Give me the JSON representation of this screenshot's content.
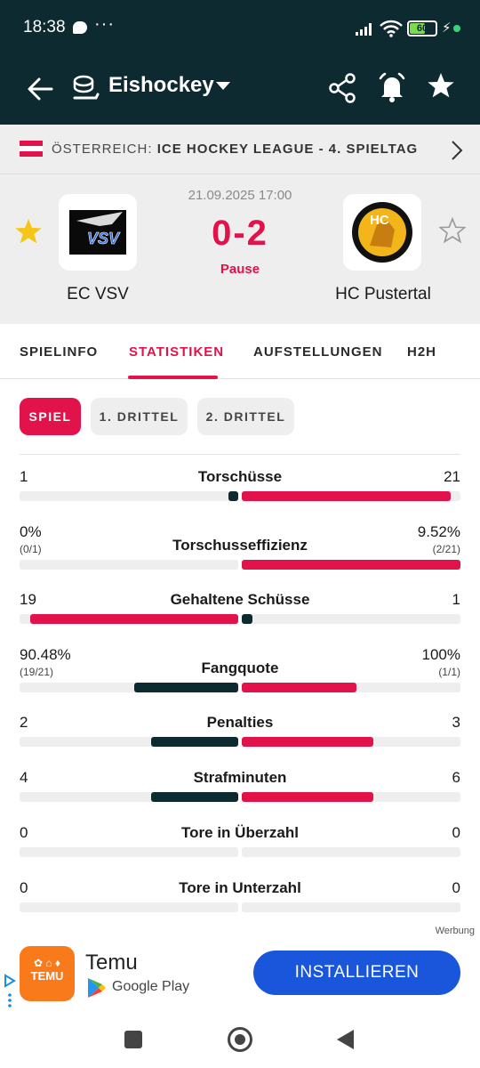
{
  "status_bar": {
    "time": "18:38",
    "dots": "···",
    "battery": "60"
  },
  "app_bar": {
    "title": "Eishockey"
  },
  "league": {
    "country": "ÖSTERREICH:",
    "name": "ICE HOCKEY LEAGUE - 4. SPIELTAG",
    "flag_colors": [
      "#e2124a",
      "#ffffff",
      "#e2124a"
    ]
  },
  "match": {
    "datetime": "21.09.2025 17:00",
    "score": "0-2",
    "status": "Pause",
    "home": {
      "name": "EC VSV",
      "logo_text": "VSV",
      "favorite": true
    },
    "away": {
      "name": "HC Pustertal",
      "logo_text": "HC",
      "favorite": false
    }
  },
  "tabs": [
    "SPIELINFO",
    "STATISTIKEN",
    "AUFSTELLUNGEN",
    "H2H"
  ],
  "active_tab": "STATISTIKEN",
  "periods": [
    "SPIEL",
    "1. DRITTEL",
    "2. DRITTEL"
  ],
  "active_period": "SPIEL",
  "stats": [
    {
      "label": "Torschüsse",
      "home": "1",
      "away": "21",
      "home_sub": "",
      "away_sub": "",
      "home_frac": 0.045,
      "away_frac": 0.955,
      "home_color": "dark",
      "away_color": "red"
    },
    {
      "label": "Torschusseffizienz",
      "home": "0%",
      "away": "9.52%",
      "home_sub": "(0/1)",
      "away_sub": "(2/21)",
      "home_frac": 0.0,
      "away_frac": 1.0,
      "home_color": "dark",
      "away_color": "red"
    },
    {
      "label": "Gehaltene Schüsse",
      "home": "19",
      "away": "1",
      "home_sub": "",
      "away_sub": "",
      "home_frac": 0.95,
      "away_frac": 0.05,
      "home_color": "red",
      "away_color": "dark"
    },
    {
      "label": "Fangquote",
      "home": "90.48%",
      "away": "100%",
      "home_sub": "(19/21)",
      "away_sub": "(1/1)",
      "home_frac": 0.475,
      "away_frac": 0.525,
      "home_color": "dark",
      "away_color": "red"
    },
    {
      "label": "Penalties",
      "home": "2",
      "away": "3",
      "home_sub": "",
      "away_sub": "",
      "home_frac": 0.4,
      "away_frac": 0.6,
      "home_color": "dark",
      "away_color": "red"
    },
    {
      "label": "Strafminuten",
      "home": "4",
      "away": "6",
      "home_sub": "",
      "away_sub": "",
      "home_frac": 0.4,
      "away_frac": 0.6,
      "home_color": "dark",
      "away_color": "red"
    },
    {
      "label": "Tore in Überzahl",
      "home": "0",
      "away": "0",
      "home_sub": "",
      "away_sub": "",
      "home_frac": 0,
      "away_frac": 0,
      "home_color": "dark",
      "away_color": "red"
    },
    {
      "label": "Tore in Unterzahl",
      "home": "0",
      "away": "0",
      "home_sub": "",
      "away_sub": "",
      "home_frac": 0,
      "away_frac": 0,
      "home_color": "dark",
      "away_color": "red"
    }
  ],
  "ad": {
    "label": "Werbung",
    "app_name": "Temu",
    "logo_text": "TEMU",
    "store": "Google Play",
    "cta": "INSTALLIEREN"
  },
  "colors": {
    "accent": "#e2124a",
    "dark": "#0e2a31",
    "install": "#1a56db",
    "temu": "#f97a1b"
  }
}
